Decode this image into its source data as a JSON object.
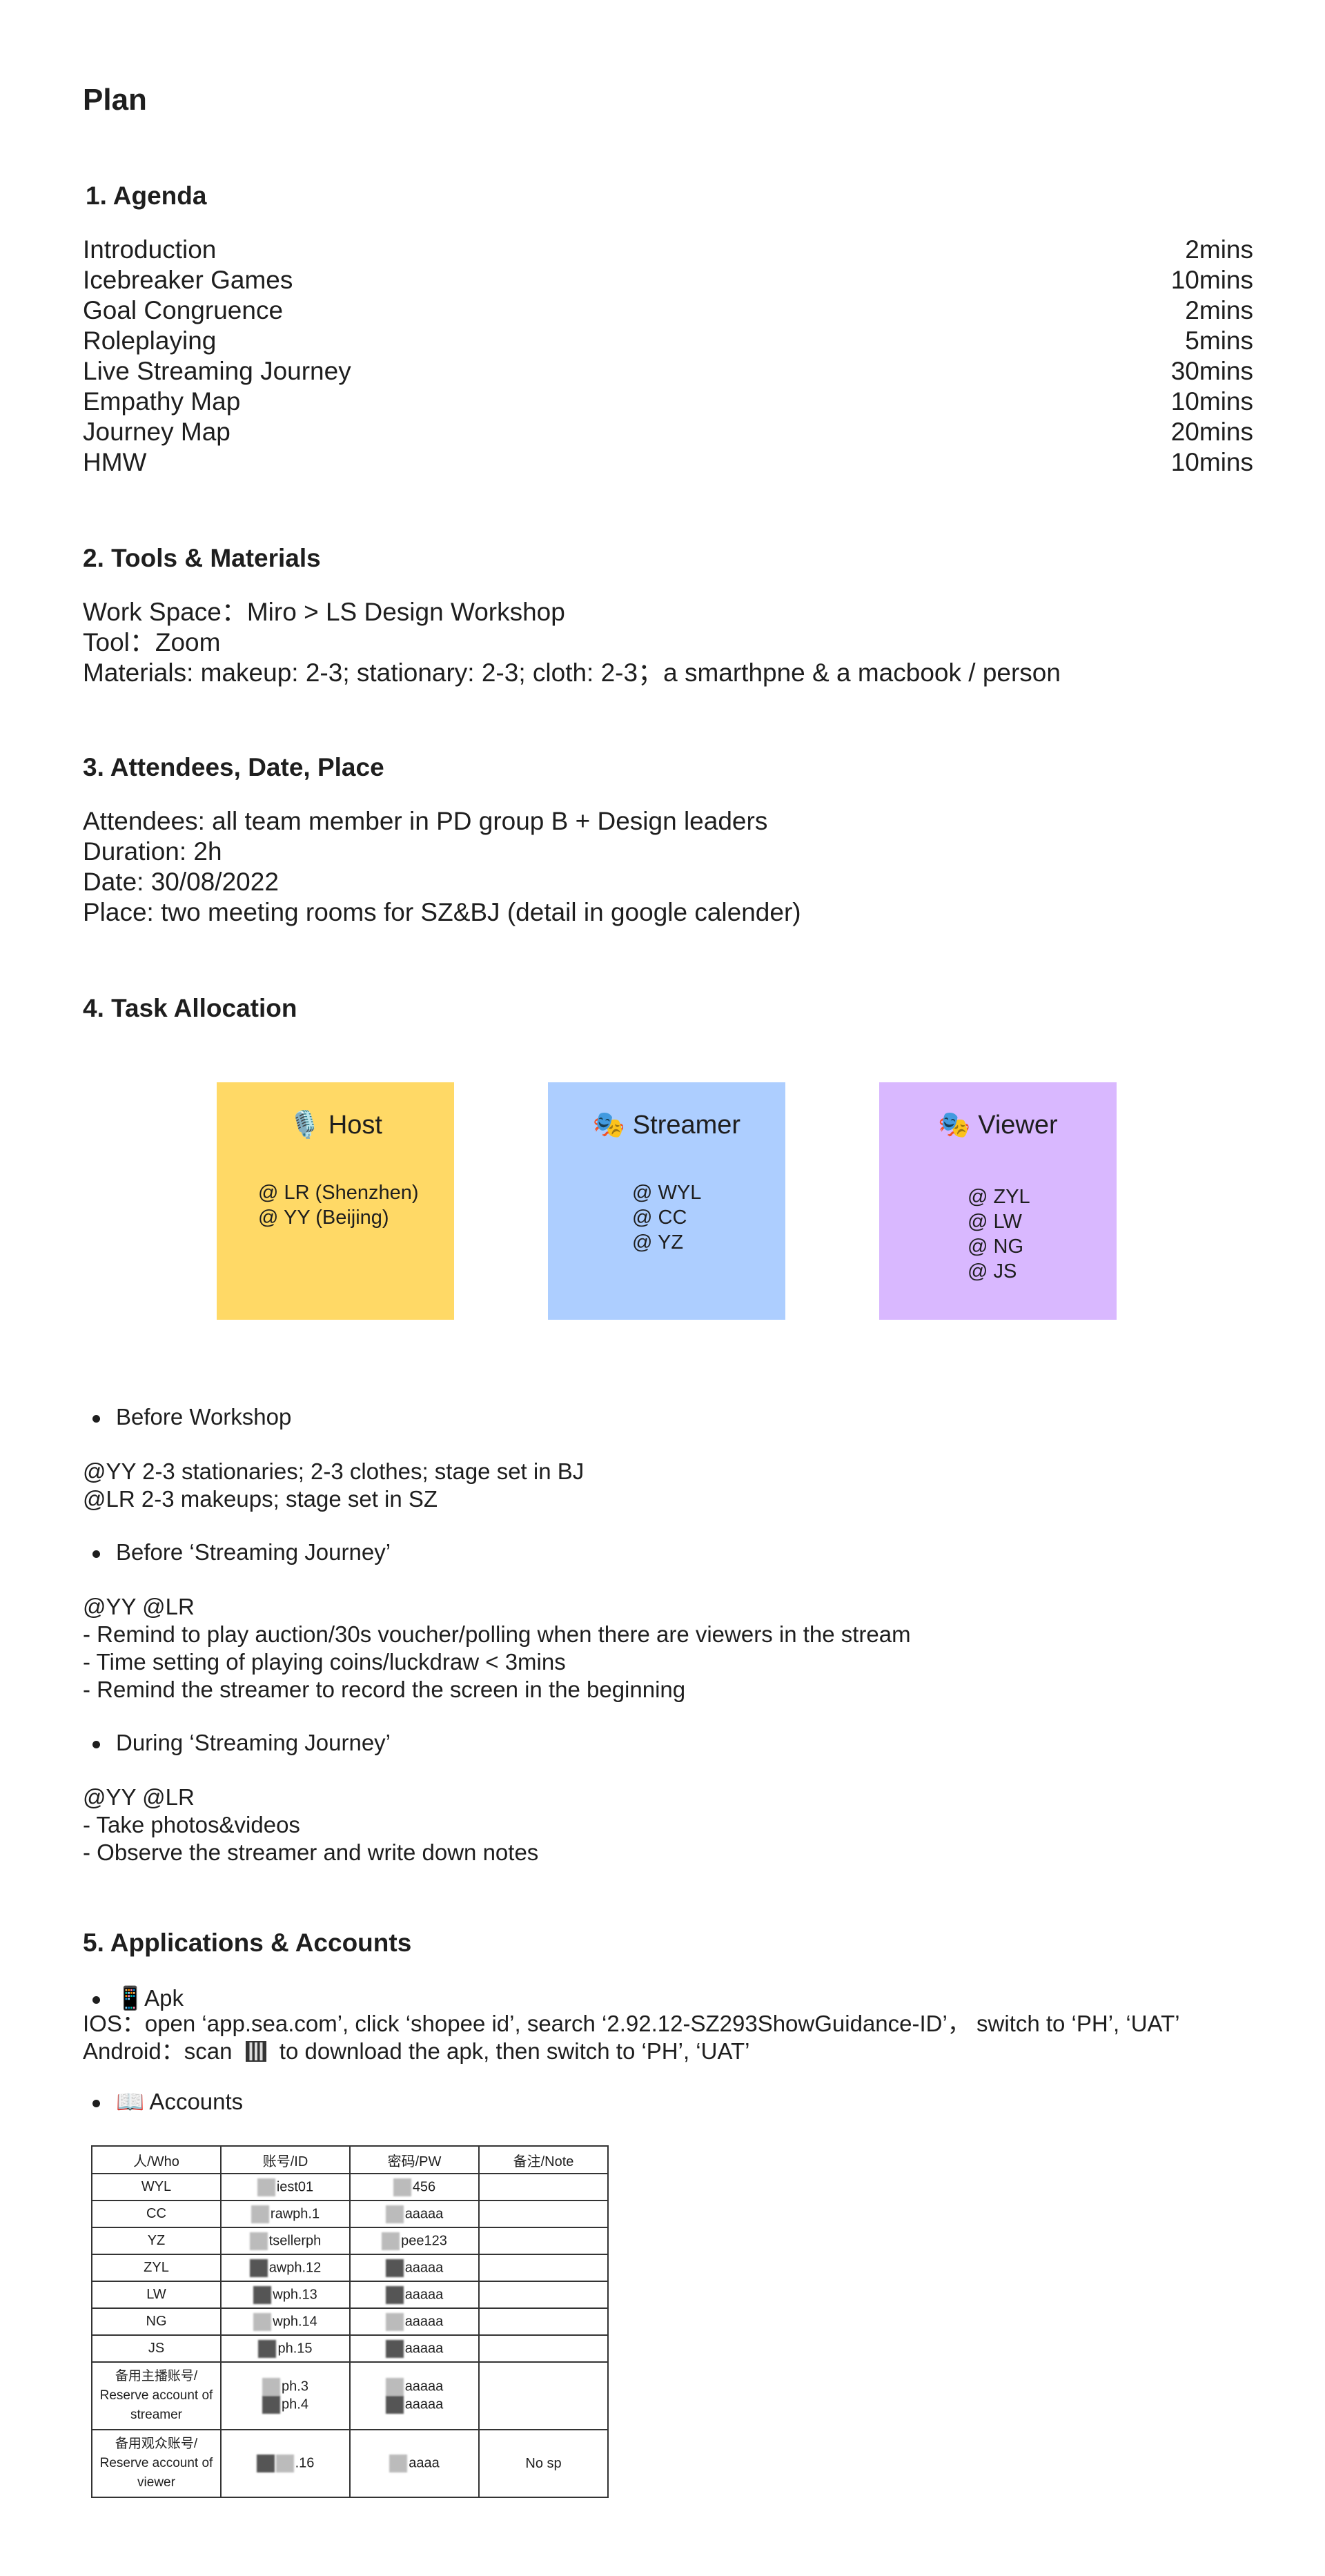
{
  "title": "Plan",
  "agenda": {
    "heading": "1. Agenda",
    "items": [
      {
        "name": "Introduction",
        "time": "2mins"
      },
      {
        "name": "Icebreaker Games",
        "time": "10mins"
      },
      {
        "name": "Goal Congruence",
        "time": "2mins"
      },
      {
        "name": "Roleplaying",
        "time": "5mins"
      },
      {
        "name": "Live Streaming Journey",
        "time": "30mins"
      },
      {
        "name": "Empathy Map",
        "time": "10mins"
      },
      {
        "name": "Journey Map",
        "time": "20mins"
      },
      {
        "name": "HMW",
        "time": "10mins"
      }
    ]
  },
  "tools": {
    "heading": "2. Tools & Materials",
    "lines": [
      "Work Space：Miro > LS Design Workshop",
      "Tool：Zoom",
      "Materials: makeup: 2-3; stationary: 2-3; cloth: 2-3；a smarthpne & a macbook / person"
    ]
  },
  "attendees": {
    "heading": "3. Attendees, Date, Place",
    "lines": [
      "Attendees: all team member in PD group B + Design leaders",
      "Duration: 2h",
      "Date: 30/08/2022",
      "Place: two meeting rooms for SZ&BJ (detail in google calender)"
    ]
  },
  "tasks": {
    "heading": "4. Task Allocation",
    "cards": [
      {
        "title": "🎙️ Host",
        "color": "#FFD966",
        "members": [
          "@ LR (Shenzhen)",
          "@ YY (Beijing)"
        ]
      },
      {
        "title": "🎭 Streamer",
        "color": "#ADCEFF",
        "members": [
          "@ WYL",
          "@ CC",
          "@ YZ"
        ]
      },
      {
        "title": "🎭 Viewer",
        "color": "#D9B8FF",
        "members": [
          "@ ZYL",
          "@ LW",
          "@ NG",
          "@ JS"
        ]
      }
    ],
    "before_workshop": {
      "label": "Before Workshop",
      "lines": [
        "@YY 2-3 stationaries; 2-3 clothes; stage set in BJ",
        "@LR 2-3 makeups; stage set in SZ"
      ]
    },
    "before_journey": {
      "label": "Before ‘Streaming Journey’",
      "lines": [
        "@YY @LR",
        "- Remind to play auction/30s voucher/polling when there are viewers in the stream",
        "- Time setting of playing coins/luckdraw < 3mins",
        "- Remind the streamer to record the screen in the beginning"
      ]
    },
    "during_journey": {
      "label": "During ‘Streaming Journey’",
      "lines": [
        "@YY @LR",
        "- Take photos&videos",
        "- Observe the streamer and write down notes"
      ]
    }
  },
  "apps": {
    "heading": "5. Applications & Accounts",
    "apk_label": "📱Apk",
    "ios_line": "IOS：open ‘app.sea.com’, click ‘shopee id’, search ‘2.92.12-SZ293ShowGuidance-ID’， switch to ‘PH’, ‘UAT’",
    "android_prefix": "Android：scan",
    "android_suffix": "to download the apk, then switch to ‘PH’, ‘UAT’",
    "accounts_label": "📖 Accounts",
    "table": {
      "headers": [
        "人/Who",
        "账号/ID",
        "密码/PW",
        "备注/Note"
      ],
      "rows": [
        [
          "WYL",
          "iest01",
          "456",
          ""
        ],
        [
          "CC",
          "rawph.1",
          "aaaaa",
          ""
        ],
        [
          "YZ",
          "tsellerph",
          "pee123",
          ""
        ],
        [
          "ZYL",
          "awph.12",
          "aaaaa",
          ""
        ],
        [
          "LW",
          "wph.13",
          "aaaaa",
          ""
        ],
        [
          "NG",
          "wph.14",
          "aaaaa",
          ""
        ],
        [
          "JS",
          "ph.15",
          "aaaaa",
          ""
        ]
      ],
      "reserve_streamer": {
        "label": "备用主播账号/\nReserve account of streamer",
        "id_1": "ph.3",
        "id_2": "ph.4",
        "pw_1": "aaaaa",
        "pw_2": "aaaaa",
        "note": ""
      },
      "reserve_viewer": {
        "label": "备用观众账号/\nReserve account of viewer",
        "id": ".16",
        "pw": "aaaa",
        "note": "No sp"
      }
    }
  }
}
